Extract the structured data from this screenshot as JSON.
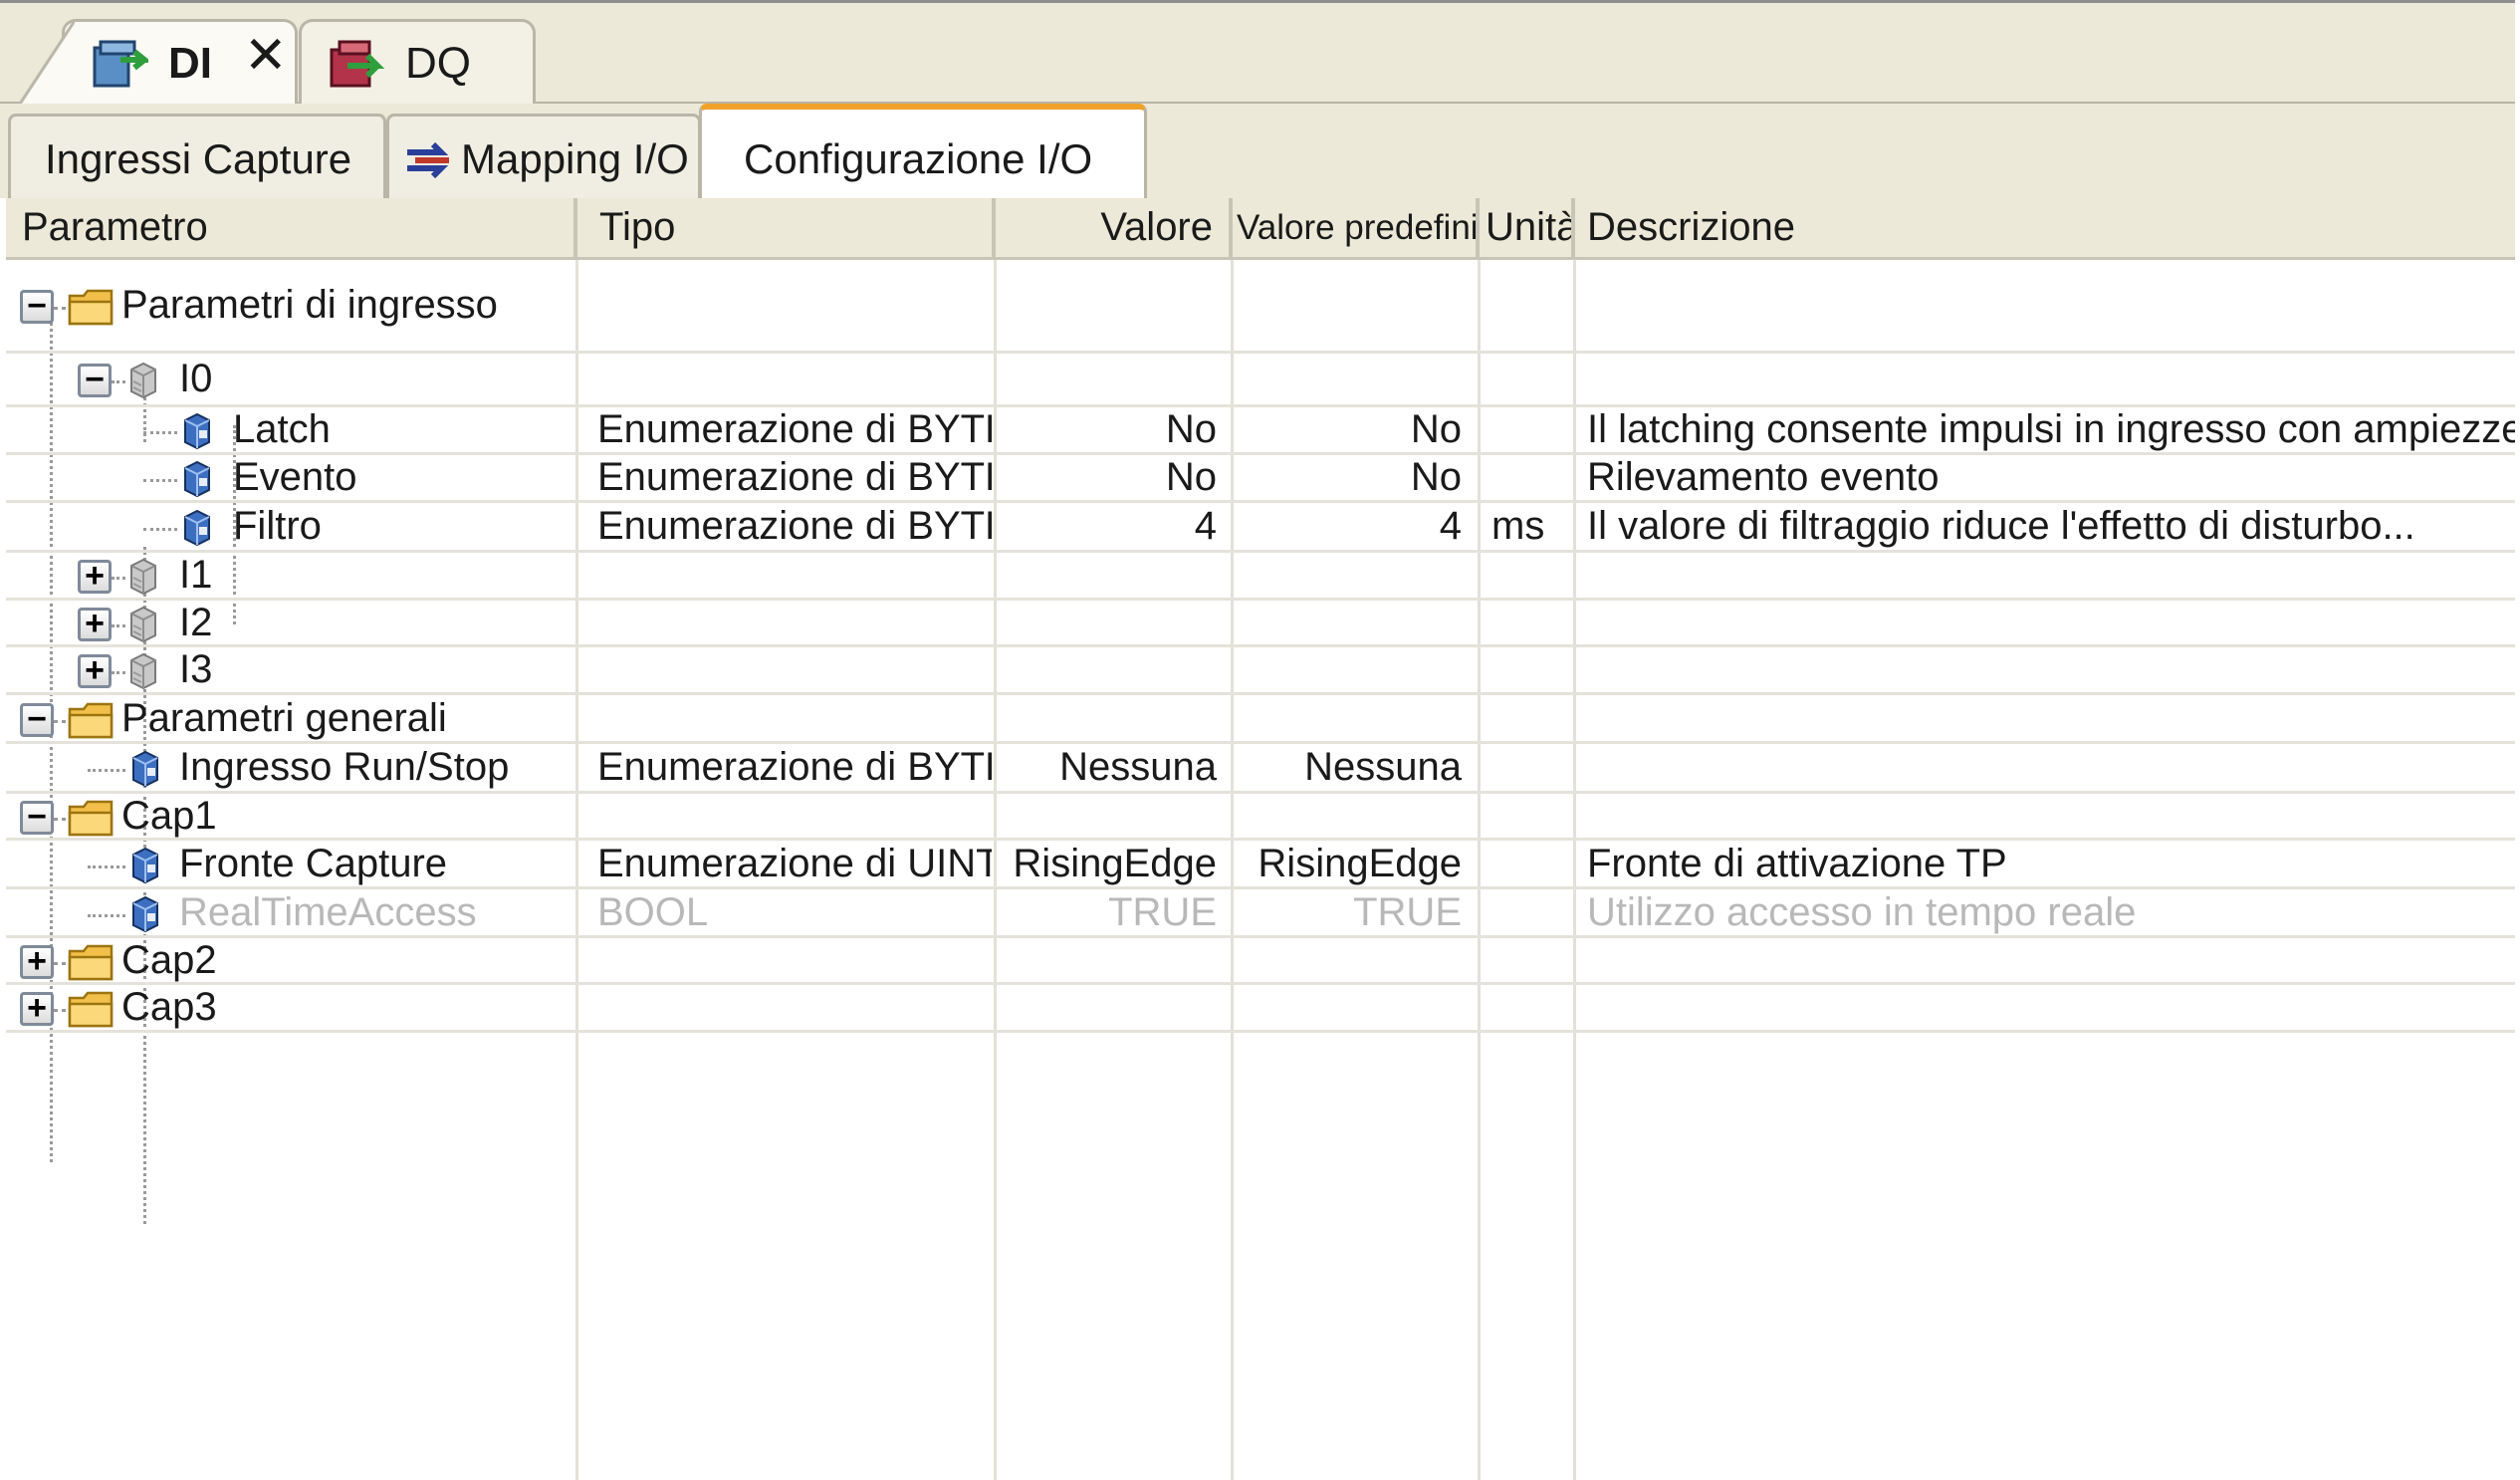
{
  "editor_tabs": [
    {
      "label": "DI",
      "active": true
    },
    {
      "label": "DQ",
      "active": false
    }
  ],
  "sub_tabs": [
    {
      "label": "Ingressi Capture"
    },
    {
      "label": "Mapping I/O"
    },
    {
      "label": "Configurazione I/O",
      "active": true
    }
  ],
  "columns": {
    "parametro": "Parametro",
    "tipo": "Tipo",
    "valore": "Valore",
    "predefinito": "Valore predefinito",
    "unita": "Unità",
    "descrizione": "Descrizione"
  },
  "rows": [
    {
      "name": "Parametri di ingresso",
      "tipo": "",
      "valore": "",
      "predefinito": "",
      "unita": "",
      "descrizione": ""
    },
    {
      "name": "I0",
      "tipo": "",
      "valore": "",
      "predefinito": "",
      "unita": "",
      "descrizione": ""
    },
    {
      "name": "Latch",
      "tipo": "Enumerazione di BYTE",
      "valore": "No",
      "predefinito": "No",
      "unita": "",
      "descrizione": "Il latching consente impulsi in ingresso con ampiezze ..."
    },
    {
      "name": "Evento",
      "tipo": "Enumerazione di BYTE",
      "valore": "No",
      "predefinito": "No",
      "unita": "",
      "descrizione": "Rilevamento evento"
    },
    {
      "name": "Filtro",
      "tipo": "Enumerazione di BYTE",
      "valore": "4",
      "predefinito": "4",
      "unita": "ms",
      "descrizione": "Il valore di filtraggio riduce l'effetto di disturbo..."
    },
    {
      "name": "I1",
      "tipo": "",
      "valore": "",
      "predefinito": "",
      "unita": "",
      "descrizione": ""
    },
    {
      "name": "I2",
      "tipo": "",
      "valore": "",
      "predefinito": "",
      "unita": "",
      "descrizione": ""
    },
    {
      "name": "I3",
      "tipo": "",
      "valore": "",
      "predefinito": "",
      "unita": "",
      "descrizione": ""
    },
    {
      "name": "Parametri generali",
      "tipo": "",
      "valore": "",
      "predefinito": "",
      "unita": "",
      "descrizione": ""
    },
    {
      "name": "Ingresso Run/Stop",
      "tipo": "Enumerazione di BYTE",
      "valore": "Nessuna",
      "predefinito": "Nessuna",
      "unita": "",
      "descrizione": ""
    },
    {
      "name": "Cap1",
      "tipo": "",
      "valore": "",
      "predefinito": "",
      "unita": "",
      "descrizione": ""
    },
    {
      "name": "Fronte Capture",
      "tipo": "Enumerazione di UINT",
      "valore": "RisingEdge",
      "predefinito": "RisingEdge",
      "unita": "",
      "descrizione": "Fronte di attivazione TP"
    },
    {
      "name": "RealTimeAccess",
      "tipo": "BOOL",
      "valore": "TRUE",
      "predefinito": "TRUE",
      "unita": "",
      "descrizione": "Utilizzo accesso in tempo reale"
    },
    {
      "name": "Cap2",
      "tipo": "",
      "valore": "",
      "predefinito": "",
      "unita": "",
      "descrizione": ""
    },
    {
      "name": "Cap3",
      "tipo": "",
      "valore": "",
      "predefinito": "",
      "unita": "",
      "descrizione": ""
    }
  ],
  "colors": {
    "active_tab_accent": "#f0a22a",
    "header_bg": "#ece9d8",
    "disabled_text": "#b8b8b8"
  }
}
